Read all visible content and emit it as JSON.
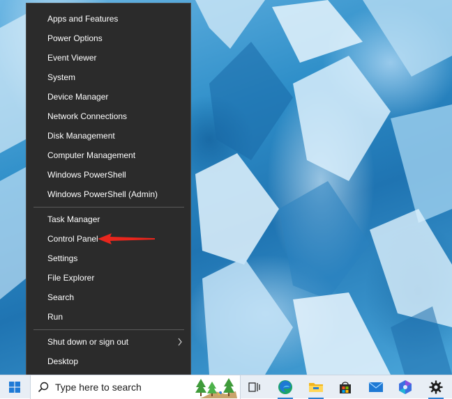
{
  "menu": {
    "group1": [
      "Apps and Features",
      "Power Options",
      "Event Viewer",
      "System",
      "Device Manager",
      "Network Connections",
      "Disk Management",
      "Computer Management",
      "Windows PowerShell",
      "Windows PowerShell (Admin)"
    ],
    "group2": [
      "Task Manager",
      "Control Panel",
      "Settings",
      "File Explorer",
      "Search",
      "Run"
    ],
    "group3": [
      "Shut down or sign out",
      "Desktop"
    ]
  },
  "taskbar": {
    "search_placeholder": "Type here to search",
    "pinned": [
      "task-view-icon",
      "edge-icon",
      "file-explorer-icon",
      "microsoft-store-icon",
      "mail-icon",
      "copilot-icon",
      "settings-icon"
    ]
  },
  "colors": {
    "menu_bg": "#2b2b2b",
    "menu_text": "#ffffff",
    "annotation_arrow": "#e8261d",
    "taskbar_bg": "#e8eef5"
  }
}
